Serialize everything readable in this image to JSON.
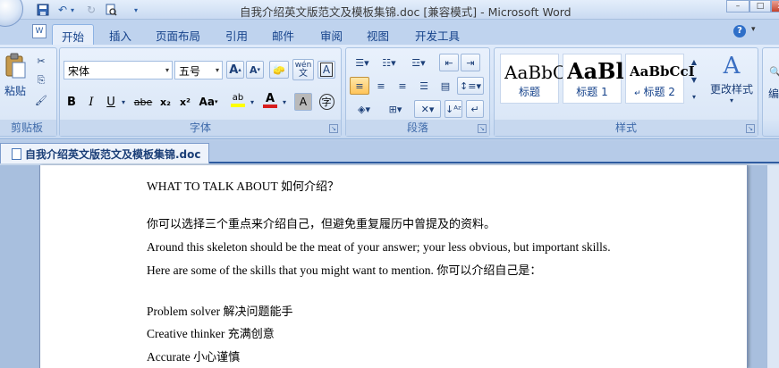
{
  "window": {
    "title": "自我介绍英文版范文及模板集锦.doc [兼容模式] - Microsoft Word",
    "controls": [
      "–",
      "□",
      "x"
    ]
  },
  "quick_access": {
    "icons": [
      "save-icon",
      "undo-icon",
      "redo-icon",
      "print-preview-icon",
      "customize-icon"
    ]
  },
  "tabs": [
    "开始",
    "插入",
    "页面布局",
    "引用",
    "邮件",
    "审阅",
    "视图",
    "开发工具"
  ],
  "help": "?",
  "ribbon": {
    "clipboard": {
      "label": "剪贴板",
      "paste_label": "粘贴"
    },
    "font": {
      "label": "字体",
      "font_name": "宋体",
      "font_size": "五号",
      "grow_label": "A",
      "shrink_label": "A",
      "phonetic_label": "wén",
      "border_char_label": "A",
      "bold": "B",
      "italic": "I",
      "underline": "U",
      "strike": "abe",
      "subscript": "x₂",
      "superscript": "x²",
      "change_case": "Aa",
      "highlight": "ab",
      "font_color": "A",
      "shade_char": "A",
      "enclose_char": "字"
    },
    "paragraph": {
      "label": "段落"
    },
    "styles": {
      "label": "样式",
      "items": [
        {
          "sample": "AaBbC",
          "name": "标题"
        },
        {
          "sample": "AaBl",
          "name": "标题 1"
        },
        {
          "sample": "AaBbCcI",
          "name": "标题 2"
        }
      ],
      "change_styles": "更改样式",
      "edit": "编"
    }
  },
  "document_tab": "自我介绍英文版范文及模板集锦.doc",
  "document": {
    "lines": [
      {
        "en": "WHAT TO TALK ABOUT ",
        "cn": " 如何介绍？"
      },
      {
        "en": "",
        "cn": "你可以选择三个重点来介绍自己，但避免重复履历中曾提及的资料。"
      },
      {
        "en": "Around this skeleton should be the meat of your answer; your less obvious, but important skills.",
        "cn": ""
      },
      {
        "en": "Here are some of the skills that you might want to mention. ",
        "cn": "你可以介绍自己是："
      },
      {
        "en": "Problem solver ",
        "cn": "解决问题能手"
      },
      {
        "en": "Creative thinker ",
        "cn": "充满创意"
      },
      {
        "en": "Accurate ",
        "cn": "小心谨慎"
      }
    ]
  },
  "colors": {
    "ribbon_text": "#15428b",
    "accent_blue": "#2f5ca1",
    "font_color_red": "#d81e1e",
    "highlight_yellow": "#ffff00"
  }
}
